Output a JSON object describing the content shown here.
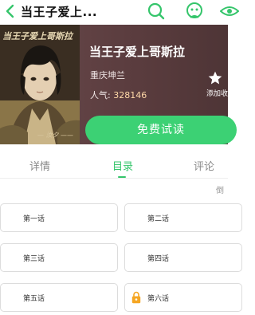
{
  "header": {
    "title": "当王子爱上...",
    "icons": [
      "back-arrow-icon",
      "search-icon",
      "face-avatar-icon",
      "eye-icon"
    ]
  },
  "book": {
    "cover_title": "当王子爱上哥斯拉",
    "cover_author": "— 汝夕 ——",
    "name": "当王子爱上哥斯拉",
    "author": "重庆坤兰",
    "popularity_label": "人气:",
    "popularity_value": "328146",
    "favorite_label": "添加收",
    "read_button": "免费试读"
  },
  "tabs": [
    {
      "label": "详情",
      "active": false
    },
    {
      "label": "目录",
      "active": true
    },
    {
      "label": "评论",
      "active": false
    }
  ],
  "sort_label": "倒",
  "chapters": [
    {
      "label": "第一话",
      "locked": false
    },
    {
      "label": "第二话",
      "locked": false
    },
    {
      "label": "第三话",
      "locked": false
    },
    {
      "label": "第四话",
      "locked": false
    },
    {
      "label": "第五话",
      "locked": false
    },
    {
      "label": "第六话",
      "locked": true
    }
  ],
  "colors": {
    "accent": "#3cd174",
    "hero_bg": "#5a3c3e",
    "lock": "#f5a623"
  }
}
